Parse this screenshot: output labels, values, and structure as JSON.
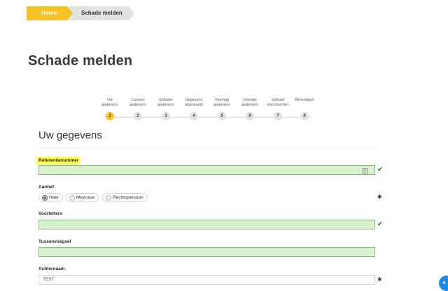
{
  "breadcrumb": {
    "home": "Home",
    "current": "Schade melden"
  },
  "page_title": "Schade melden",
  "steps": [
    {
      "label": "Uw\ngegevens",
      "num": "1"
    },
    {
      "label": "Contact\ngegevens",
      "num": "2"
    },
    {
      "label": "Schade-\ngegevens",
      "num": "3"
    },
    {
      "label": "Gegevens\ntegenpartij",
      "num": "4"
    },
    {
      "label": "Voertuig\ngegevens",
      "num": "5"
    },
    {
      "label": "Overige\ngegevens",
      "num": "6"
    },
    {
      "label": "Upload\ndocumenten",
      "num": "7"
    },
    {
      "label": "Bevestigen",
      "num": "8"
    }
  ],
  "section_title": "Uw gegevens",
  "fields": {
    "referentienummer": {
      "label": "Referentienummer",
      "value": ""
    },
    "aanhef": {
      "label": "Aanhef",
      "options": [
        "Heer",
        "Mevrouw",
        "Rechtspersoon"
      ],
      "selected": "Heer"
    },
    "voorletters": {
      "label": "Voorletters",
      "value": "."
    },
    "tussenvoegsel": {
      "label": "Tussenvoegsel",
      "value": ""
    },
    "achternaam": {
      "label": "Achternaam",
      "value": "TEST"
    }
  },
  "icons": {
    "check": "✔",
    "required": "✱",
    "card": "▤"
  },
  "colors": {
    "accent": "#f6c226",
    "valid_bg": "#d9f0cf",
    "valid_border": "#7fbf6c",
    "check": "#2e8b2e",
    "fab": "#1e88e5"
  }
}
